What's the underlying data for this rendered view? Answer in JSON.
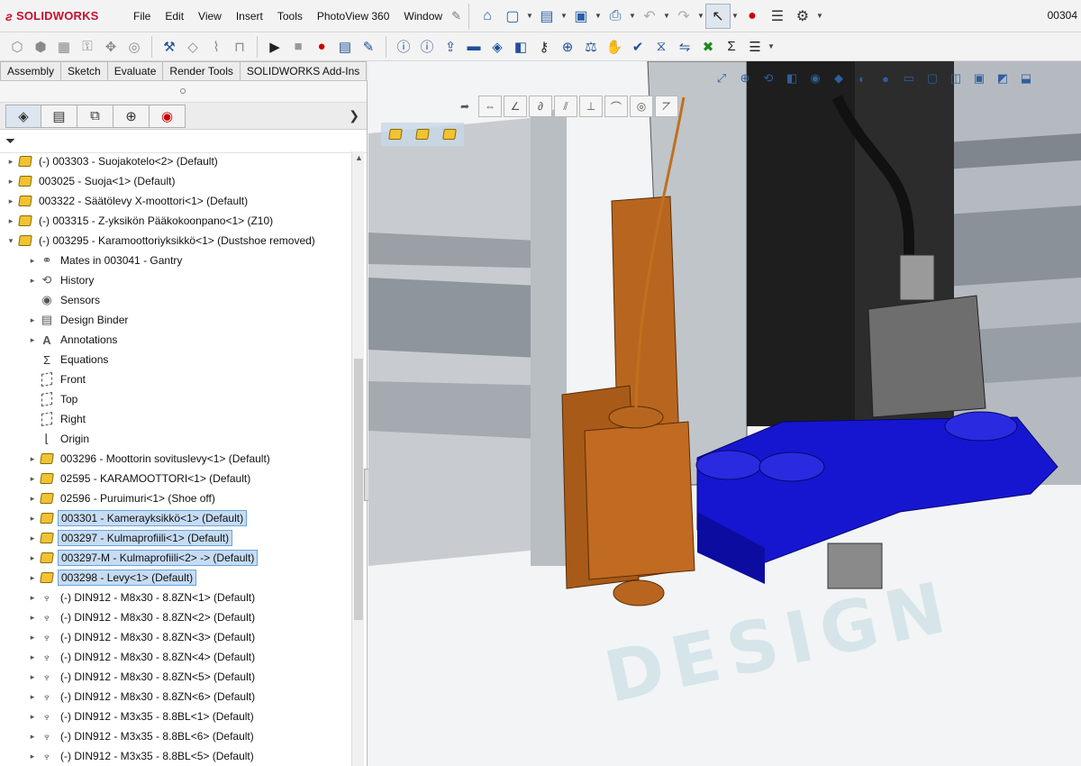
{
  "app": {
    "brand": "SOLIDWORKS",
    "window_title": "00304"
  },
  "menubar": {
    "items": [
      "File",
      "Edit",
      "View",
      "Insert",
      "Tools",
      "PhotoView 360",
      "Window"
    ]
  },
  "tabs": [
    "Assembly",
    "Sketch",
    "Evaluate",
    "Render Tools",
    "SOLIDWORKS Add-Ins"
  ],
  "tree": {
    "items": [
      {
        "depth": 0,
        "expand": "collapsed",
        "icon": "assembly-icon",
        "label": "(-) 003303 - Suojakotelo<2> (Default)",
        "selected": false
      },
      {
        "depth": 0,
        "expand": "collapsed",
        "icon": "assembly-icon",
        "label": "003025 - Suoja<1> (Default)",
        "selected": false
      },
      {
        "depth": 0,
        "expand": "collapsed",
        "icon": "assembly-icon",
        "label": "003322 - Säätölevy X-moottori<1> (Default)",
        "selected": false
      },
      {
        "depth": 0,
        "expand": "collapsed",
        "icon": "assembly-icon",
        "label": "(-) 003315 - Z-yksikön Pääkokoonpano<1> (Z10)",
        "selected": false
      },
      {
        "depth": 0,
        "expand": "expanded",
        "icon": "assembly-icon",
        "label": "(-) 003295 - Karamoottoriyksikkö<1> (Dustshoe removed)",
        "selected": false
      },
      {
        "depth": 1,
        "expand": "collapsed",
        "icon": "mates-icon",
        "label": "Mates in 003041 - Gantry",
        "selected": false
      },
      {
        "depth": 1,
        "expand": "collapsed",
        "icon": "history-icon",
        "label": "History",
        "selected": false
      },
      {
        "depth": 1,
        "expand": "none",
        "icon": "sensors-icon",
        "label": "Sensors",
        "selected": false
      },
      {
        "depth": 1,
        "expand": "collapsed",
        "icon": "design-binder-icon",
        "label": "Design Binder",
        "selected": false
      },
      {
        "depth": 1,
        "expand": "collapsed",
        "icon": "annotations-icon",
        "label": "Annotations",
        "selected": false
      },
      {
        "depth": 1,
        "expand": "none",
        "icon": "equations-icon",
        "label": "Equations",
        "selected": false
      },
      {
        "depth": 1,
        "expand": "none",
        "icon": "plane-icon",
        "label": "Front",
        "selected": false
      },
      {
        "depth": 1,
        "expand": "none",
        "icon": "plane-icon",
        "label": "Top",
        "selected": false
      },
      {
        "depth": 1,
        "expand": "none",
        "icon": "plane-icon",
        "label": "Right",
        "selected": false
      },
      {
        "depth": 1,
        "expand": "none",
        "icon": "origin-icon",
        "label": "Origin",
        "selected": false
      },
      {
        "depth": 1,
        "expand": "collapsed",
        "icon": "assembly-icon",
        "label": "003296 - Moottorin sovituslevy<1> (Default)",
        "selected": false
      },
      {
        "depth": 1,
        "expand": "collapsed",
        "icon": "assembly-icon",
        "label": "02595 - KARAMOOTTORI<1> (Default)",
        "selected": false
      },
      {
        "depth": 1,
        "expand": "collapsed",
        "icon": "assembly-icon",
        "label": "02596 - Puruimuri<1> (Shoe off)",
        "selected": false
      },
      {
        "depth": 1,
        "expand": "collapsed",
        "icon": "assembly-icon",
        "label": "003301 - Kamerayksikkö<1> (Default)",
        "selected": true
      },
      {
        "depth": 1,
        "expand": "collapsed",
        "icon": "assembly-icon",
        "label": "003297 - Kulmaprofiili<1> (Default)",
        "selected": true
      },
      {
        "depth": 1,
        "expand": "collapsed",
        "icon": "assembly-icon",
        "label": "003297-M - Kulmaprofiili<2> -> (Default)",
        "selected": true
      },
      {
        "depth": 1,
        "expand": "collapsed",
        "icon": "assembly-icon",
        "label": "003298 - Levy<1> (Default)",
        "selected": true
      },
      {
        "depth": 1,
        "expand": "collapsed",
        "icon": "bolt-icon",
        "label": "(-) DIN912 - M8x30 - 8.8ZN<1> (Default)",
        "selected": false
      },
      {
        "depth": 1,
        "expand": "collapsed",
        "icon": "bolt-icon",
        "label": "(-) DIN912 - M8x30 - 8.8ZN<2> (Default)",
        "selected": false
      },
      {
        "depth": 1,
        "expand": "collapsed",
        "icon": "bolt-icon",
        "label": "(-) DIN912 - M8x30 - 8.8ZN<3> (Default)",
        "selected": false
      },
      {
        "depth": 1,
        "expand": "collapsed",
        "icon": "bolt-icon",
        "label": "(-) DIN912 - M8x30 - 8.8ZN<4> (Default)",
        "selected": false
      },
      {
        "depth": 1,
        "expand": "collapsed",
        "icon": "bolt-icon",
        "label": "(-) DIN912 - M8x30 - 8.8ZN<5> (Default)",
        "selected": false
      },
      {
        "depth": 1,
        "expand": "collapsed",
        "icon": "bolt-icon",
        "label": "(-) DIN912 - M8x30 - 8.8ZN<6> (Default)",
        "selected": false
      },
      {
        "depth": 1,
        "expand": "collapsed",
        "icon": "bolt-icon",
        "label": "(-) DIN912 - M3x35 - 8.8BL<1> (Default)",
        "selected": false
      },
      {
        "depth": 1,
        "expand": "collapsed",
        "icon": "bolt-icon",
        "label": "(-) DIN912 - M3x35 - 8.8BL<6> (Default)",
        "selected": false
      },
      {
        "depth": 1,
        "expand": "collapsed",
        "icon": "bolt-icon",
        "label": "(-) DIN912 - M3x35 - 8.8BL<5> (Default)",
        "selected": false
      }
    ]
  },
  "viewport": {
    "watermark": "DESIGN",
    "colors": {
      "camera_unit": "#b8661f",
      "plate": "#1616d0",
      "spindle": "#1e1e1e",
      "frame": "#8e9399",
      "background": "#f2f4f6"
    }
  }
}
